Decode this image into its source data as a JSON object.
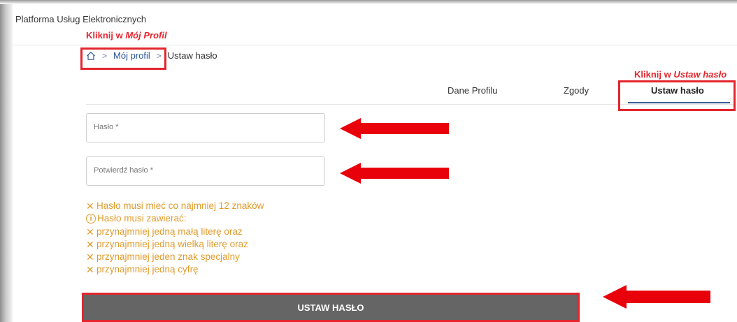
{
  "app": {
    "title": "Platforma Usług Elektronicznych"
  },
  "annotations": {
    "breadcrumb_prefix": "Kliknij w ",
    "breadcrumb_target": "Mój Profil",
    "tab_prefix": "Kliknij w ",
    "tab_target": "Ustaw hasło",
    "color": "#e3262d"
  },
  "breadcrumb": {
    "home_icon": "home-icon",
    "separator": ">",
    "items": [
      "Mój profil",
      "Ustaw hasło"
    ]
  },
  "tabs": [
    {
      "label": "Dane Profilu",
      "active": false
    },
    {
      "label": "Zgody",
      "active": false
    },
    {
      "label": "Ustaw hasło",
      "active": true
    }
  ],
  "form": {
    "password_placeholder": "Hasło *",
    "confirm_placeholder": "Potwierdź hasło *",
    "rules": [
      {
        "icon": "x-icon",
        "text": "Hasło musi mieć co najmniej 12 znaków"
      },
      {
        "icon": "info-icon",
        "text": "Hasło musi zawierać:"
      },
      {
        "icon": "x-icon",
        "text": "przynajmniej jedną małą literę oraz"
      },
      {
        "icon": "x-icon",
        "text": "przynajmniej jedną wielką literę oraz"
      },
      {
        "icon": "x-icon",
        "text": "przynajmniej jeden znak specjalny"
      },
      {
        "icon": "x-icon",
        "text": "przynajmniej jedną cyfrę"
      }
    ],
    "rule_color": "#e19b2c",
    "submit_label": "USTAW HASŁO"
  },
  "colors": {
    "accent": "#3b5e95",
    "button": "#656565",
    "link": "#2b5797"
  }
}
